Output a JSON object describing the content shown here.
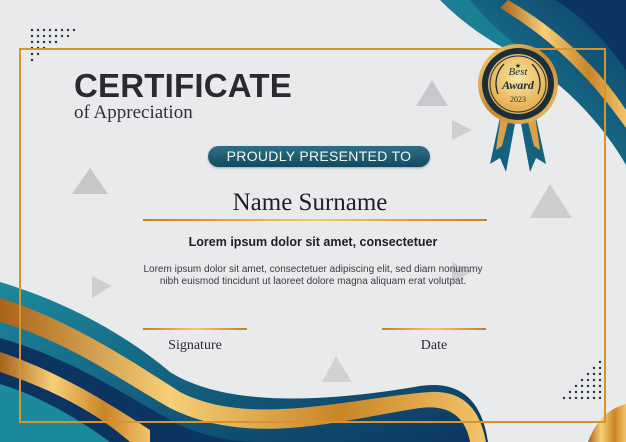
{
  "certificate": {
    "title": "CERTIFICATE",
    "subtitle": "of Appreciation",
    "presented_label": "PROUDLY PRESENTED TO",
    "recipient_name": "Name Surname",
    "lead_text": "Lorem ipsum dolor sit amet, consectetuer",
    "body_text": "Lorem ipsum dolor sit amet, consectetuer adipiscing elit, sed diam nonummy nibh euismod tincidunt ut laoreet dolore magna aliquam erat volutpat.",
    "signature_label": "Signature",
    "date_label": "Date"
  },
  "badge": {
    "line1": "Best",
    "line2": "Award",
    "year": "2023",
    "icon": "award-medal-icon"
  },
  "colors": {
    "background": "#e9eaec",
    "navy": "#0d3b66",
    "teal": "#1b7a8c",
    "gold": "#d8932e",
    "pill": "#1f5f76"
  }
}
